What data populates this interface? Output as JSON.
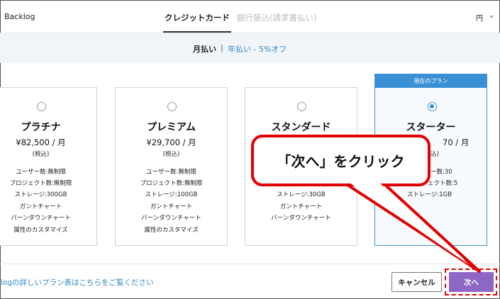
{
  "header": {
    "brand": "Backlog",
    "tabs": [
      {
        "label": "クレジットカード",
        "active": true
      },
      {
        "label": "銀行振込(請求書払い)",
        "active": false
      }
    ],
    "currency": "円"
  },
  "billing": {
    "monthly": "月払い",
    "separator": "|",
    "yearly": "年払い - 5%オフ"
  },
  "plans": [
    {
      "name": "プラチナ",
      "price": "¥82,500 / 月",
      "tax": "(税込)",
      "selected": false,
      "features": [
        "ユーザー数:無制限",
        "プロジェクト数:無制限",
        "ストレージ:300GB",
        "ガントチャート",
        "バーンダウンチャート",
        "属性のカスタマイズ"
      ]
    },
    {
      "name": "プレミアム",
      "price": "¥29,700 / 月",
      "tax": "(税込)",
      "selected": false,
      "features": [
        "ユーザー数:無制限",
        "プロジェクト数:無制限",
        "ストレージ:100GB",
        "ガントチャート",
        "バーンダウンチャート",
        "属性のカスタマイズ"
      ]
    },
    {
      "name": "スタンダード",
      "price": "",
      "tax": "",
      "selected": false,
      "features": [
        "",
        "",
        "ストレージ:30GB",
        "ガントチャート",
        "バーンダウンチャート"
      ]
    },
    {
      "name": "スターター",
      "price": "70 / 月",
      "tax": "込)",
      "selected": true,
      "current_label": "現在のプラン",
      "features": [
        "ー数:30",
        "ェクト数:5",
        "ストレージ:1GB"
      ]
    }
  ],
  "footer": {
    "plan_link": "logの詳しいプラン表はこちらをご覧ください",
    "cancel": "キャンセル",
    "next": "次へ"
  },
  "annotation": {
    "callout": "「次へ」をクリック"
  },
  "colors": {
    "accent_blue": "#3b8fd4",
    "link_blue": "#2f87c8",
    "next_purple": "#8e66c6",
    "highlight_red": "#e00000"
  }
}
